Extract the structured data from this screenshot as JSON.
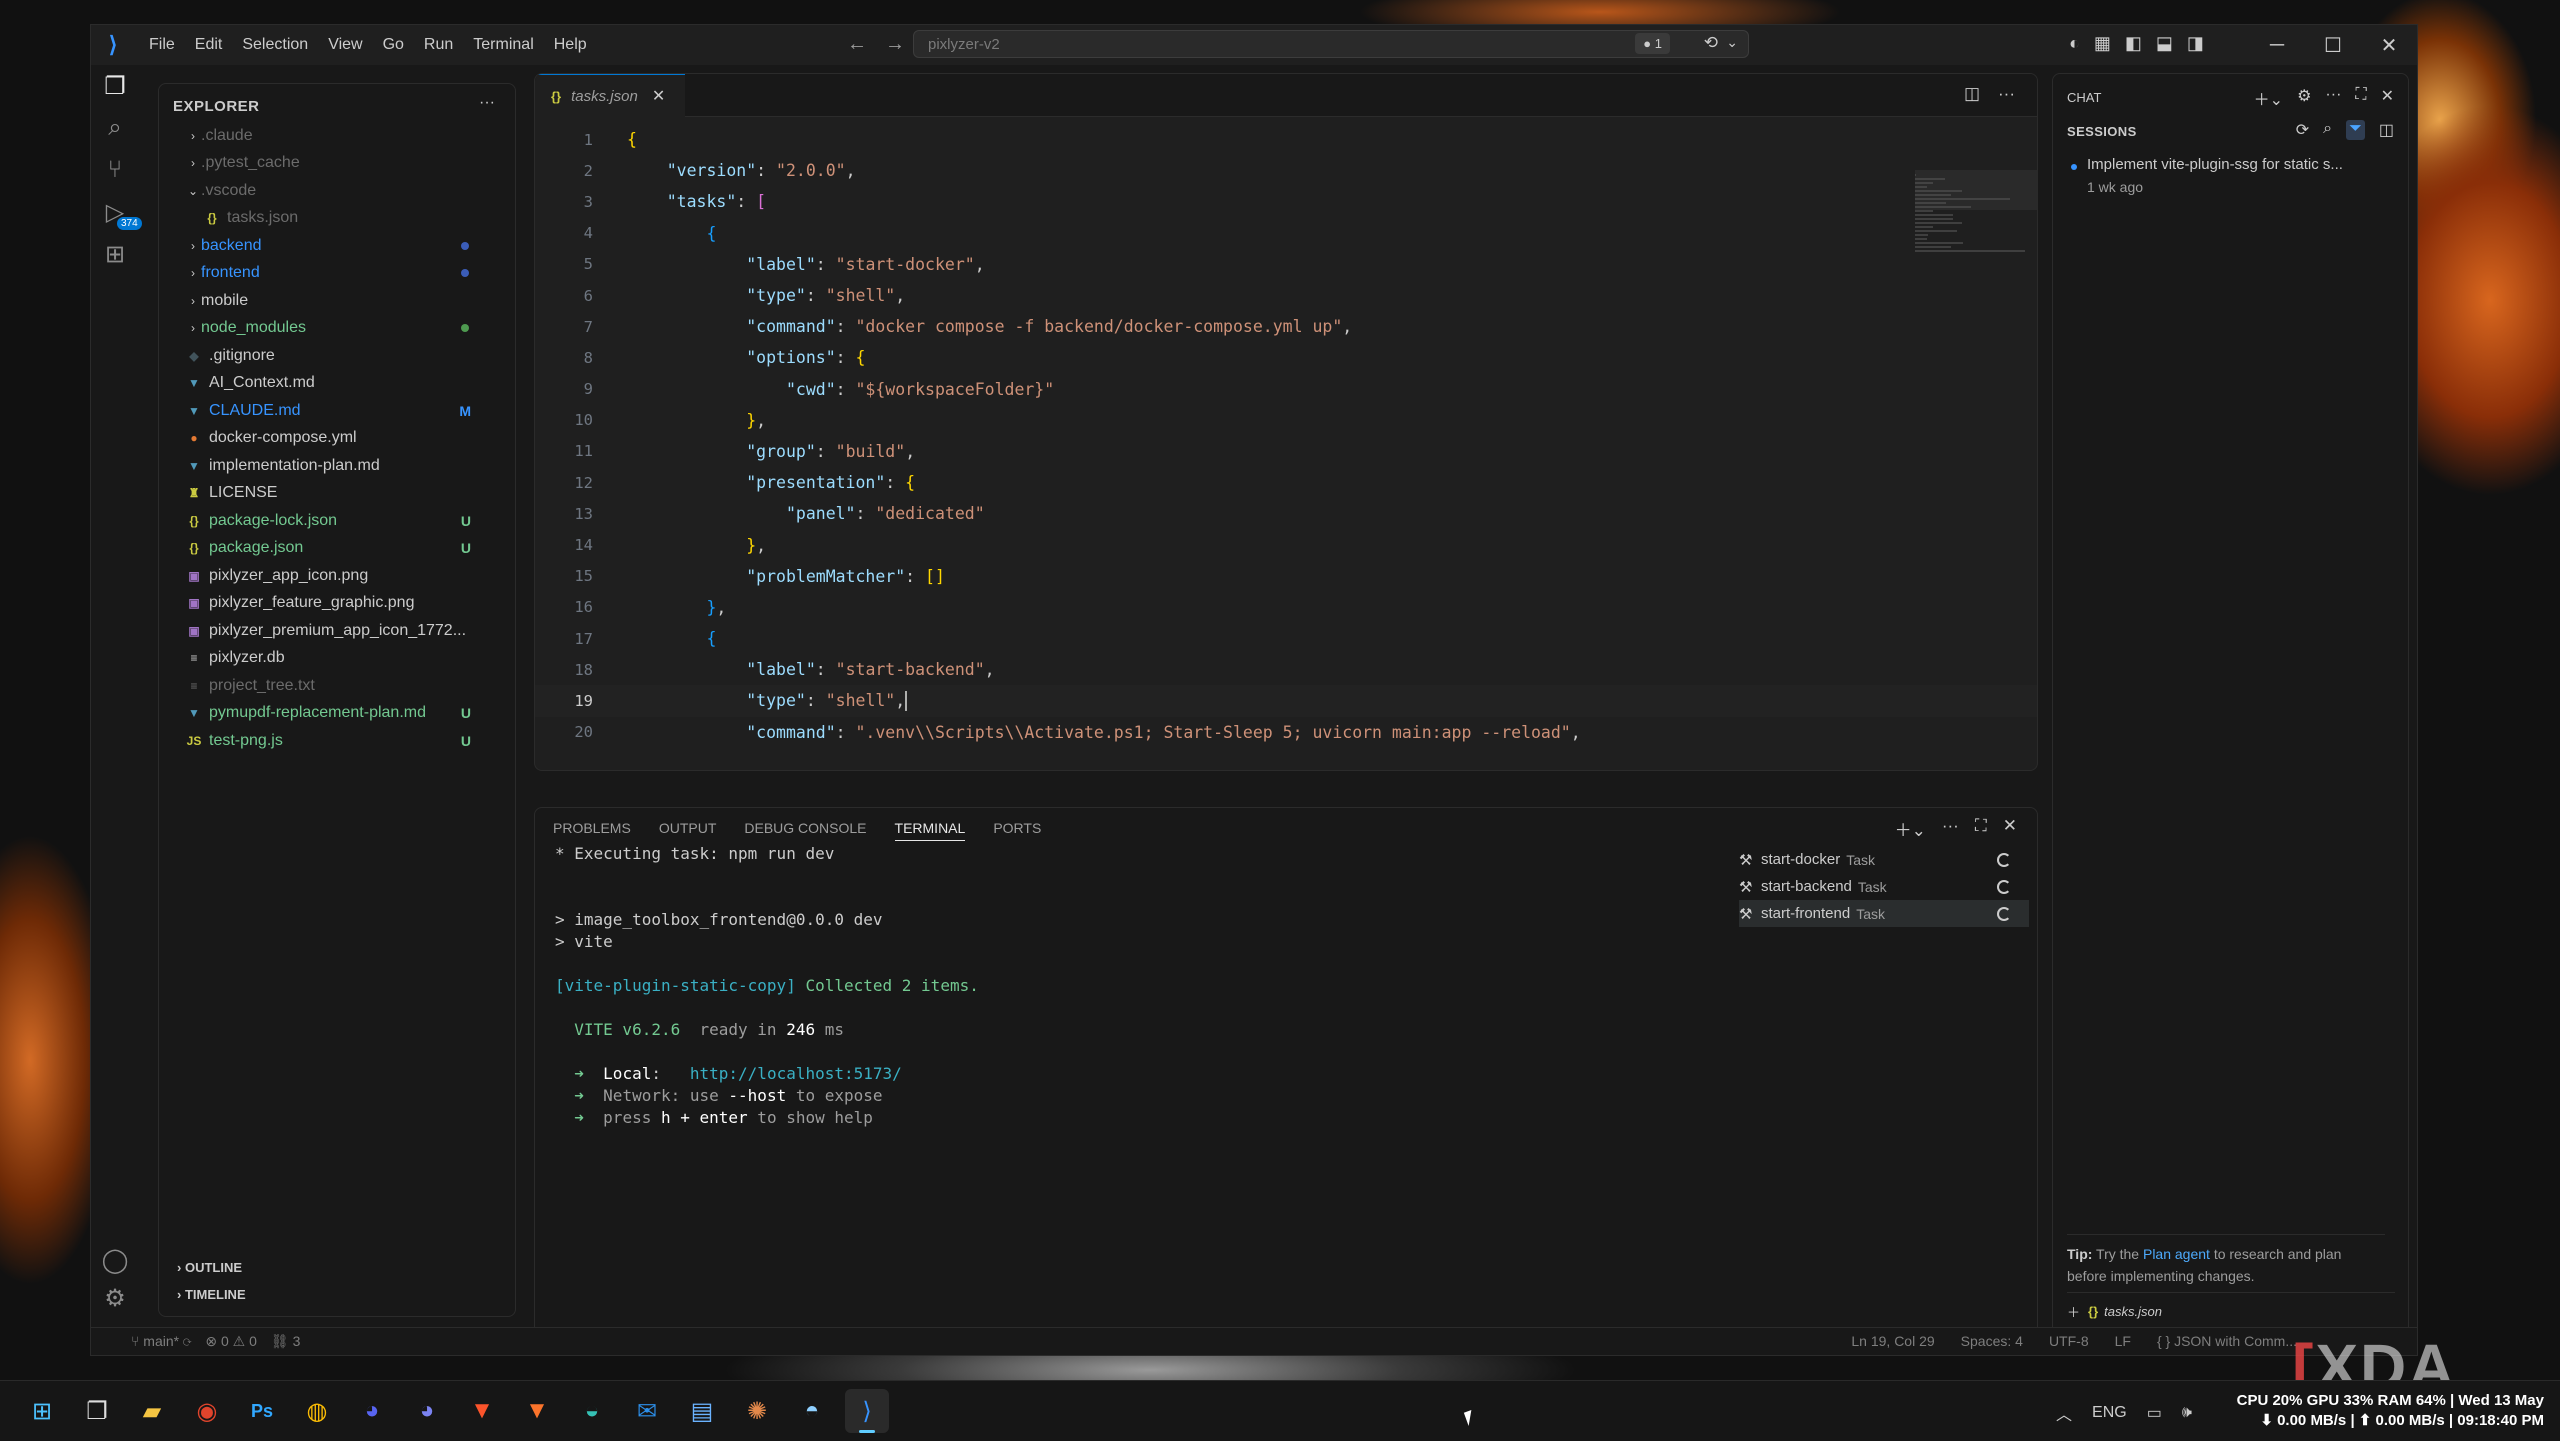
{
  "window": {
    "menu": [
      "File",
      "Edit",
      "Selection",
      "View",
      "Go",
      "Run",
      "Terminal",
      "Help"
    ],
    "search_text": "pixlyzer-v2",
    "badge": "● 1"
  },
  "explorer": {
    "title": "EXPLORER",
    "items": [
      {
        "name": ".claude",
        "type": "folder",
        "depth": 0,
        "color": "#6b6b6b"
      },
      {
        "name": ".pytest_cache",
        "type": "folder",
        "depth": 0,
        "color": "#6b6b6b"
      },
      {
        "name": ".vscode",
        "type": "folder-open",
        "depth": 0,
        "color": "#6b6b6b"
      },
      {
        "name": "tasks.json",
        "type": "file",
        "icon": "{}",
        "icon_color": "#cbcb41",
        "depth": 1,
        "color": "#6b6b6b"
      },
      {
        "name": "backend",
        "type": "folder",
        "depth": 0,
        "color": "#3794ff",
        "dot": "#3b5db8"
      },
      {
        "name": "frontend",
        "type": "folder",
        "depth": 0,
        "color": "#3794ff",
        "dot": "#3b5db8"
      },
      {
        "name": "mobile",
        "type": "folder",
        "depth": 0,
        "color": "#cccccc"
      },
      {
        "name": "node_modules",
        "type": "folder",
        "depth": 0,
        "color": "#73c991",
        "dot": "#4e9a50"
      },
      {
        "name": ".gitignore",
        "type": "file",
        "icon": "◆",
        "icon_color": "#41535b",
        "depth": 0,
        "color": "#cccccc"
      },
      {
        "name": "AI_Context.md",
        "type": "file",
        "icon": "▼",
        "icon_color": "#519aba",
        "depth": 0,
        "color": "#cccccc"
      },
      {
        "name": "CLAUDE.md",
        "type": "file",
        "icon": "▼",
        "icon_color": "#519aba",
        "depth": 0,
        "color": "#3794ff",
        "status": "M",
        "status_color": "#3794ff"
      },
      {
        "name": "docker-compose.yml",
        "type": "file",
        "icon": "●",
        "icon_color": "#e37933",
        "depth": 0,
        "color": "#cccccc"
      },
      {
        "name": "implementation-plan.md",
        "type": "file",
        "icon": "▼",
        "icon_color": "#519aba",
        "depth": 0,
        "color": "#cccccc"
      },
      {
        "name": "LICENSE",
        "type": "file",
        "icon": "♜",
        "icon_color": "#cbcb41",
        "depth": 0,
        "color": "#cccccc"
      },
      {
        "name": "package-lock.json",
        "type": "file",
        "icon": "{}",
        "icon_color": "#cbcb41",
        "depth": 0,
        "color": "#73c991",
        "status": "U",
        "status_color": "#73c991"
      },
      {
        "name": "package.json",
        "type": "file",
        "icon": "{}",
        "icon_color": "#cbcb41",
        "depth": 0,
        "color": "#73c991",
        "status": "U",
        "status_color": "#73c991"
      },
      {
        "name": "pixlyzer_app_icon.png",
        "type": "file",
        "icon": "▣",
        "icon_color": "#a074c4",
        "depth": 0,
        "color": "#cccccc"
      },
      {
        "name": "pixlyzer_feature_graphic.png",
        "type": "file",
        "icon": "▣",
        "icon_color": "#a074c4",
        "depth": 0,
        "color": "#cccccc"
      },
      {
        "name": "pixlyzer_premium_app_icon_1772...",
        "type": "file",
        "icon": "▣",
        "icon_color": "#a074c4",
        "depth": 0,
        "color": "#cccccc"
      },
      {
        "name": "pixlyzer.db",
        "type": "file",
        "icon": "≡",
        "icon_color": "#cccccc",
        "depth": 0,
        "color": "#cccccc"
      },
      {
        "name": "project_tree.txt",
        "type": "file",
        "icon": "≡",
        "icon_color": "#6b6b6b",
        "depth": 0,
        "color": "#6b6b6b"
      },
      {
        "name": "pymupdf-replacement-plan.md",
        "type": "file",
        "icon": "▼",
        "icon_color": "#519aba",
        "depth": 0,
        "color": "#73c991",
        "status": "U",
        "status_color": "#73c991"
      },
      {
        "name": "test-png.js",
        "type": "file",
        "icon": "JS",
        "icon_color": "#cbcb41",
        "depth": 0,
        "color": "#73c991",
        "status": "U",
        "status_color": "#73c991"
      }
    ],
    "outline": "OUTLINE",
    "timeline": "TIMELINE"
  },
  "editor": {
    "tab": "tasks.json",
    "lines": [
      "1",
      "2",
      "3",
      "4",
      "5",
      "6",
      "7",
      "8",
      "9",
      "10",
      "11",
      "12",
      "13",
      "14",
      "15",
      "16",
      "17",
      "18",
      "19",
      "20"
    ],
    "code": [
      [
        [
          "{",
          "b1"
        ]
      ],
      [
        [
          "    ",
          ""
        ],
        [
          "\"version\"",
          "k"
        ],
        [
          ": ",
          "p"
        ],
        [
          "\"2.0.0\"",
          "s"
        ],
        [
          ",",
          "p"
        ]
      ],
      [
        [
          "    ",
          ""
        ],
        [
          "\"tasks\"",
          "k"
        ],
        [
          ": ",
          "p"
        ],
        [
          "[",
          "b2"
        ]
      ],
      [
        [
          "        ",
          ""
        ],
        [
          "{",
          "b3"
        ]
      ],
      [
        [
          "            ",
          ""
        ],
        [
          "\"label\"",
          "k"
        ],
        [
          ": ",
          "p"
        ],
        [
          "\"start-docker\"",
          "s"
        ],
        [
          ",",
          "p"
        ]
      ],
      [
        [
          "            ",
          ""
        ],
        [
          "\"type\"",
          "k"
        ],
        [
          ": ",
          "p"
        ],
        [
          "\"shell\"",
          "s"
        ],
        [
          ",",
          "p"
        ]
      ],
      [
        [
          "            ",
          ""
        ],
        [
          "\"command\"",
          "k"
        ],
        [
          ": ",
          "p"
        ],
        [
          "\"docker compose -f backend/docker-compose.yml up\"",
          "s"
        ],
        [
          ",",
          "p"
        ]
      ],
      [
        [
          "            ",
          ""
        ],
        [
          "\"options\"",
          "k"
        ],
        [
          ": ",
          "p"
        ],
        [
          "{",
          "b1"
        ]
      ],
      [
        [
          "                ",
          ""
        ],
        [
          "\"cwd\"",
          "k"
        ],
        [
          ": ",
          "p"
        ],
        [
          "\"${workspaceFolder}\"",
          "s"
        ]
      ],
      [
        [
          "            ",
          ""
        ],
        [
          "}",
          "b1"
        ],
        [
          ",",
          "p"
        ]
      ],
      [
        [
          "            ",
          ""
        ],
        [
          "\"group\"",
          "k"
        ],
        [
          ": ",
          "p"
        ],
        [
          "\"build\"",
          "s"
        ],
        [
          ",",
          "p"
        ]
      ],
      [
        [
          "            ",
          ""
        ],
        [
          "\"presentation\"",
          "k"
        ],
        [
          ": ",
          "p"
        ],
        [
          "{",
          "b1"
        ]
      ],
      [
        [
          "                ",
          ""
        ],
        [
          "\"panel\"",
          "k"
        ],
        [
          ": ",
          "p"
        ],
        [
          "\"dedicated\"",
          "s"
        ]
      ],
      [
        [
          "            ",
          ""
        ],
        [
          "}",
          "b1"
        ],
        [
          ",",
          "p"
        ]
      ],
      [
        [
          "            ",
          ""
        ],
        [
          "\"problemMatcher\"",
          "k"
        ],
        [
          ": ",
          "p"
        ],
        [
          "[]",
          "b1"
        ]
      ],
      [
        [
          "        ",
          ""
        ],
        [
          "}",
          "b3"
        ],
        [
          ",",
          "p"
        ]
      ],
      [
        [
          "        ",
          ""
        ],
        [
          "{",
          "b3"
        ]
      ],
      [
        [
          "            ",
          ""
        ],
        [
          "\"label\"",
          "k"
        ],
        [
          ": ",
          "p"
        ],
        [
          "\"start-backend\"",
          "s"
        ],
        [
          ",",
          "p"
        ]
      ],
      [
        [
          "            ",
          ""
        ],
        [
          "\"type\"",
          "k"
        ],
        [
          ": ",
          "p"
        ],
        [
          "\"shell\"",
          "s"
        ],
        [
          ",",
          "p"
        ]
      ],
      [
        [
          "            ",
          ""
        ],
        [
          "\"command\"",
          "k"
        ],
        [
          ": ",
          "p"
        ],
        [
          "\".venv\\\\Scripts\\\\Activate.ps1; Start-Sleep 5; uvicorn main:app --reload\"",
          "s"
        ],
        [
          ",",
          "p"
        ]
      ]
    ],
    "current_line": 19
  },
  "panel": {
    "tabs": [
      "PROBLEMS",
      "OUTPUT",
      "DEBUG CONSOLE",
      "TERMINAL",
      "PORTS"
    ],
    "active_tab": "TERMINAL",
    "terminal": [
      [
        [
          "* ",
          "#cccccc"
        ],
        [
          "Executing task: npm run dev",
          "#cccccc"
        ]
      ],
      [
        [
          "",
          ""
        ]
      ],
      [
        [
          "",
          ""
        ]
      ],
      [
        [
          "> image_toolbox_frontend@0.0.0 dev",
          "#cccccc"
        ]
      ],
      [
        [
          "> vite",
          "#cccccc"
        ]
      ],
      [
        [
          "",
          ""
        ]
      ],
      [
        [
          "[vite-plugin-static-copy] ",
          "#3ab0c4"
        ],
        [
          "Collected 2 items.",
          "#73c991"
        ]
      ],
      [
        [
          "",
          ""
        ]
      ],
      [
        [
          "  VITE v6.2.6",
          "#73c991"
        ],
        [
          "  ready in ",
          "#9d9d9d"
        ],
        [
          "246",
          "#ffffff"
        ],
        [
          " ms",
          "#9d9d9d"
        ]
      ],
      [
        [
          "",
          ""
        ]
      ],
      [
        [
          "  ➜  ",
          "#73c991"
        ],
        [
          "Local",
          "#ffffff"
        ],
        [
          ":   ",
          "#cccccc"
        ],
        [
          "http://localhost:",
          "#3ab0c4"
        ],
        [
          "5173",
          "#3ab0c4"
        ],
        [
          "/",
          "#3ab0c4"
        ]
      ],
      [
        [
          "  ➜  ",
          "#73c991"
        ],
        [
          "Network",
          "#9d9d9d"
        ],
        [
          ": use ",
          "#9d9d9d"
        ],
        [
          "--host",
          "#ffffff"
        ],
        [
          " to expose",
          "#9d9d9d"
        ]
      ],
      [
        [
          "  ➜  ",
          "#73c991"
        ],
        [
          "press ",
          "#9d9d9d"
        ],
        [
          "h + enter",
          "#ffffff"
        ],
        [
          " to show help",
          "#9d9d9d"
        ]
      ]
    ],
    "tasks": [
      {
        "name": "start-docker",
        "kind": "Task"
      },
      {
        "name": "start-backend",
        "kind": "Task"
      },
      {
        "name": "start-frontend",
        "kind": "Task"
      }
    ]
  },
  "chat": {
    "title": "CHAT",
    "sessions_label": "SESSIONS",
    "session_title": "Implement vite-plugin-ssg for static s...",
    "session_age": "1 wk ago",
    "tip_prefix": "Tip:",
    "tip_mid": " Try the ",
    "tip_link": "Plan agent",
    "tip_suffix": " to research and plan before implementing changes.",
    "context_file": "tasks.json"
  },
  "statusbar": {
    "branch": "main*",
    "problems": "⊗ 0 ⚠ 0",
    "ports": "3",
    "position": "Ln 19, Col 29",
    "spaces": "Spaces: 4",
    "encoding": "UTF-8",
    "eol": "LF",
    "language": "{ } JSON with Comm..."
  },
  "taskbar": {
    "lang": "ENG",
    "sys_line1": "CPU 20% GPU 33% RAM 64% | Wed 13 May",
    "sys_line2": "⬇ 0.00 MB/s | ⬆ 0.00 MB/s | 09:18:40 PM"
  },
  "watermark": "XDA"
}
